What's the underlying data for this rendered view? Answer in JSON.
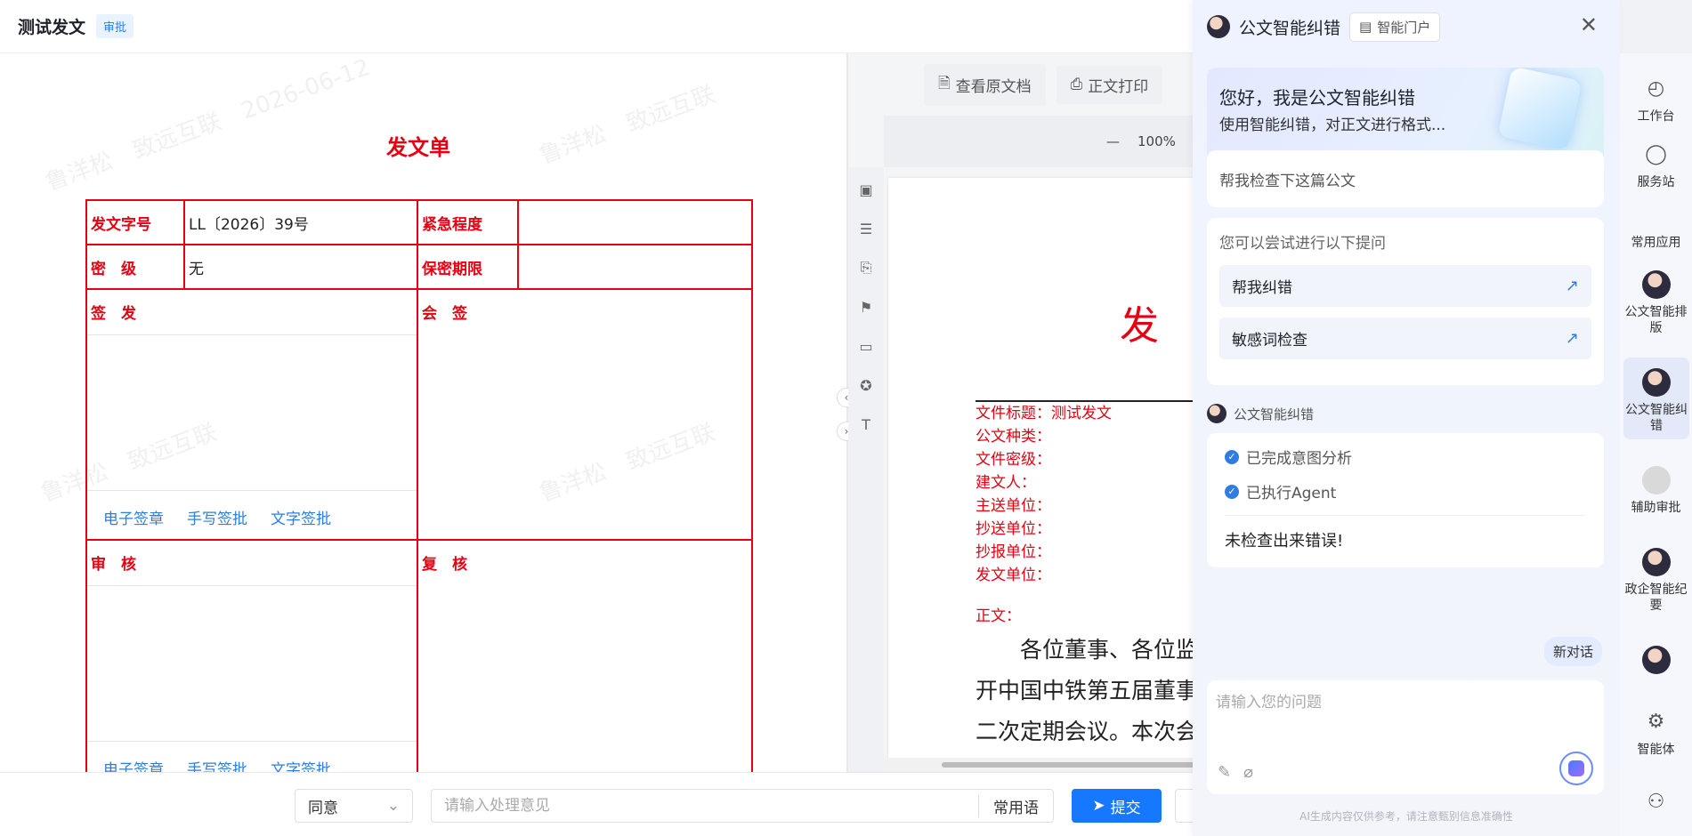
{
  "header": {
    "title": "测试发文",
    "badge": "审批"
  },
  "form": {
    "title": "发文单",
    "fields": {
      "doc_no_label": "发文字号",
      "doc_no_value": "LL〔2026〕39号",
      "urgency_label": "紧急程度",
      "urgency_value": "",
      "secret_label": "密　级",
      "secret_value": "无",
      "secret_period_label": "保密期限",
      "secret_period_value": ""
    },
    "sign_sections": {
      "issue": "签　发",
      "countersign": "会　签",
      "review": "审　核",
      "recheck": "复　核"
    },
    "sign_links": {
      "electronic": "电子签章",
      "handwriting": "手写签批",
      "text": "文字签批"
    },
    "watermark_name": "鲁洋松",
    "watermark_org": "致远互联",
    "watermark_date": "2026-06-12"
  },
  "viewer": {
    "view_original": "查看原文档",
    "print": "正文打印",
    "zoom": "100%",
    "page_big": "发",
    "meta": {
      "title_label": "文件标题：",
      "title_value": "测试发文",
      "type": "公文种类：",
      "secret": "文件密级：",
      "proposer": "建文人：",
      "main_send": "主送单位：",
      "copy_send": "抄送单位：",
      "copy_report": "抄报单位：",
      "issue_unit": "发文单位："
    },
    "body_label": "正文：",
    "body_lines": [
      "　　各位董事、各位监",
      "开中国中铁第五届董事",
      "二次定期会议。本次会"
    ]
  },
  "action_bar": {
    "select_value": "同意",
    "opinion_placeholder": "请输入处理意见",
    "common_phrases": "常用语",
    "submit": "提交"
  },
  "ai": {
    "name": "公文智能纠错",
    "portal": "智能门户",
    "greeting": "您好，我是公文智能纠错",
    "intro": "使用智能纠错，对正文进行格式...",
    "quick_prompt": "帮我检查下这篇公文",
    "suggest_title": "您可以尝试进行以下提问",
    "suggestions": [
      "帮我纠错",
      "敏感词检查"
    ],
    "agent_name": "公文智能纠错",
    "steps": [
      "已完成意图分析",
      "已执行Agent"
    ],
    "result": "未检查出来错误!",
    "new_chat": "新对话",
    "input_placeholder": "请输入您的问题",
    "disclaimer": "AI生成内容仅供参考，请注意甄别信息准确性"
  },
  "rail": {
    "workbench": "工作台",
    "service": "服务站",
    "common_apps": "常用应用",
    "app1": "公文智能排版",
    "app2": "公文智能纠错",
    "app3": "辅助审批",
    "app4": "政企智能纪要",
    "agent": "智能体"
  }
}
